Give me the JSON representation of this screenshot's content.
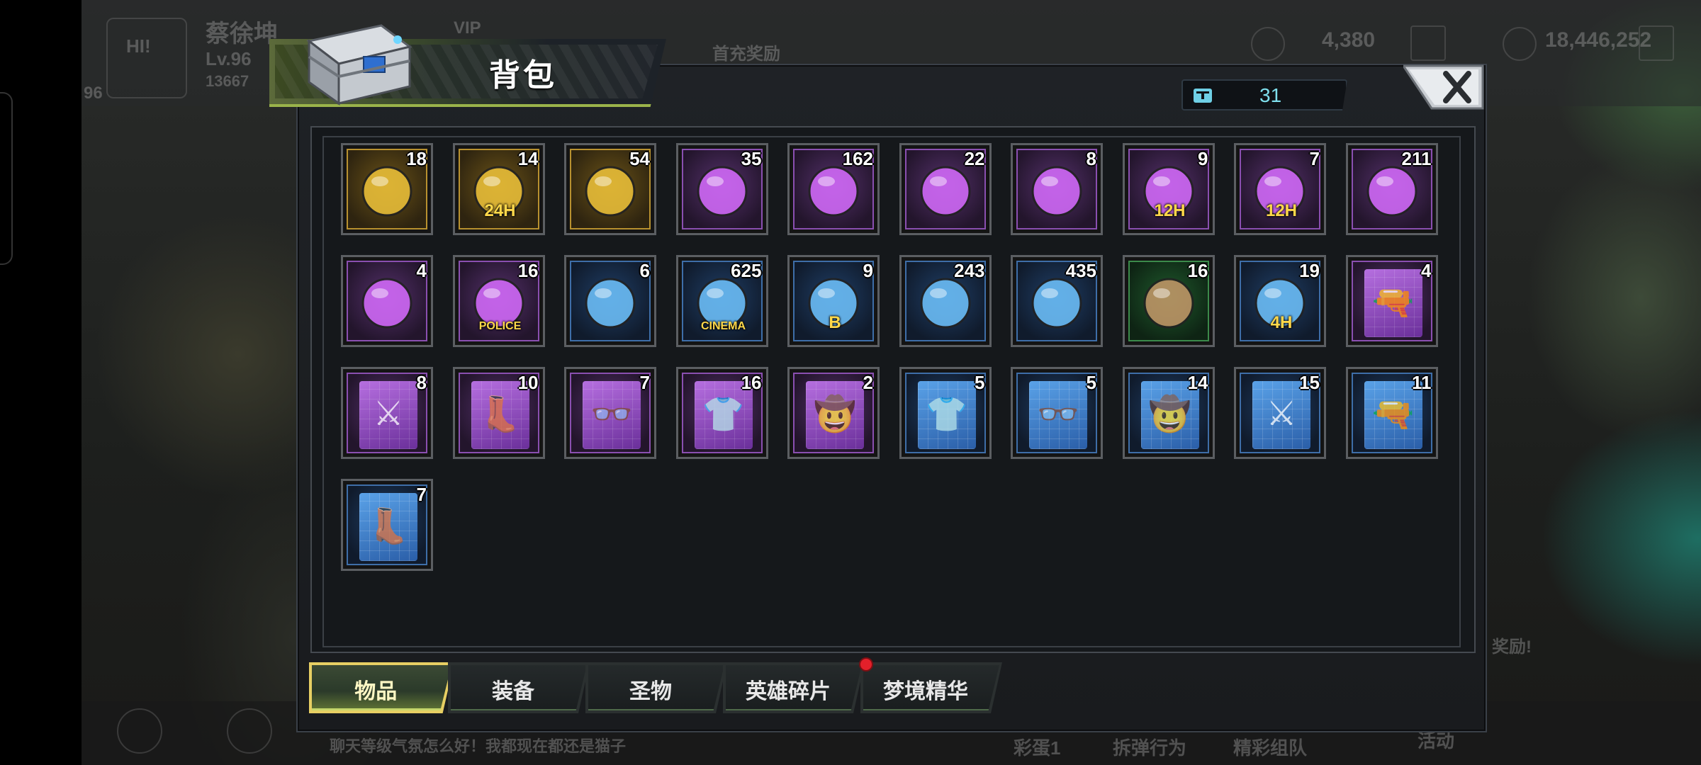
{
  "background": {
    "player_name": "蔡徐坤",
    "player_level": "Lv.96",
    "player_id": "13667",
    "level_badge": "96",
    "hi_bubble": "HI!",
    "vip_label": "VIP",
    "first_charge_label": "首充奖励",
    "diamonds": "4,380",
    "gold": "18,446,252",
    "right_reward_label": "奖励!",
    "chat_text": "聊天等级气氛怎么好！我都现在都还是猫子",
    "bottom_btn_1": "彩蛋1",
    "bottom_btn_2": "拆弹行为",
    "bottom_btn_3": "精彩组队",
    "bottom_btn_4": "活动"
  },
  "dialog": {
    "title": "背包",
    "capacity_count": "31",
    "capacity_icon": "storage-box-icon",
    "close_icon": "close-icon"
  },
  "items": [
    {
      "count": "18",
      "icon": "golden-egg-icon",
      "rarity": "gold"
    },
    {
      "count": "14",
      "icon": "gold-card-24h-icon",
      "label": "24H",
      "rarity": "gold"
    },
    {
      "count": "54",
      "icon": "red-bottlecap-icon",
      "rarity": "gold"
    },
    {
      "count": "35",
      "icon": "silver-watch-icon",
      "rarity": "purple"
    },
    {
      "count": "162",
      "icon": "crystal-icon",
      "rarity": "purple"
    },
    {
      "count": "22",
      "icon": "film-reel-icon",
      "rarity": "purple"
    },
    {
      "count": "8",
      "icon": "hourglass-icon",
      "rarity": "purple"
    },
    {
      "count": "9",
      "icon": "gem-card-12h-icon",
      "label": "12H",
      "rarity": "purple"
    },
    {
      "count": "7",
      "icon": "gold-card-12h-icon",
      "label": "12H",
      "rarity": "purple"
    },
    {
      "count": "211",
      "icon": "pink-bottlecap-icon",
      "rarity": "purple"
    },
    {
      "count": "4",
      "icon": "spade-chip-icon",
      "rarity": "purple"
    },
    {
      "count": "16",
      "icon": "police-badge-icon",
      "label": "POLICE",
      "rarity": "purple"
    },
    {
      "count": "6",
      "icon": "bunny-coin-icon",
      "rarity": "blue"
    },
    {
      "count": "625",
      "icon": "cinema-ticket-icon",
      "label": "CINEMA",
      "rarity": "blue"
    },
    {
      "count": "9",
      "icon": "blue-bottlecap-icon",
      "label": "B",
      "rarity": "blue"
    },
    {
      "count": "243",
      "icon": "red-poker-chip-icon",
      "rarity": "blue"
    },
    {
      "count": "435",
      "icon": "bullet-icon",
      "rarity": "blue"
    },
    {
      "count": "16",
      "icon": "fluffy-creature-icon",
      "rarity": "green"
    },
    {
      "count": "19",
      "icon": "gold-card-4h-icon",
      "label": "4H",
      "rarity": "blue"
    },
    {
      "count": "4",
      "icon": "pistol-blueprint-icon",
      "rarity": "purple",
      "card": "purple",
      "glyph": "🔫"
    },
    {
      "count": "8",
      "icon": "swords-blueprint-icon",
      "rarity": "purple",
      "card": "purple",
      "glyph": "⚔"
    },
    {
      "count": "10",
      "icon": "boots-blueprint-icon",
      "rarity": "purple",
      "card": "purple",
      "glyph": "👢"
    },
    {
      "count": "7",
      "icon": "glasses-blueprint-icon",
      "rarity": "purple",
      "card": "purple",
      "glyph": "👓"
    },
    {
      "count": "16",
      "icon": "tshirt-blueprint-icon",
      "rarity": "purple",
      "card": "purple",
      "glyph": "👕"
    },
    {
      "count": "2",
      "icon": "hat-blueprint-icon",
      "rarity": "purple",
      "card": "purple",
      "glyph": "🤠"
    },
    {
      "count": "5",
      "icon": "tshirt-blueprint-icon",
      "rarity": "blue",
      "card": "blue",
      "glyph": "👕"
    },
    {
      "count": "5",
      "icon": "glasses-blueprint-icon",
      "rarity": "blue",
      "card": "blue",
      "glyph": "👓"
    },
    {
      "count": "14",
      "icon": "hat-blueprint-icon",
      "rarity": "blue",
      "card": "blue",
      "glyph": "🤠"
    },
    {
      "count": "15",
      "icon": "swords-blueprint-icon",
      "rarity": "blue",
      "card": "blue",
      "glyph": "⚔"
    },
    {
      "count": "11",
      "icon": "pistol-blueprint-icon",
      "rarity": "blue",
      "card": "blue",
      "glyph": "🔫"
    },
    {
      "count": "7",
      "icon": "boots-blueprint-icon",
      "rarity": "blue",
      "card": "blue",
      "glyph": "👢"
    }
  ],
  "tabs": [
    {
      "label": "物品",
      "active": true
    },
    {
      "label": "装备",
      "active": false
    },
    {
      "label": "圣物",
      "active": false
    },
    {
      "label": "英雄碎片",
      "active": false,
      "badge": true
    },
    {
      "label": "梦境精华",
      "active": false
    }
  ],
  "colors": {
    "accent_yellow": "#e7cf63",
    "counter_text": "#7fe0ee",
    "badge_red": "#e3202a"
  }
}
